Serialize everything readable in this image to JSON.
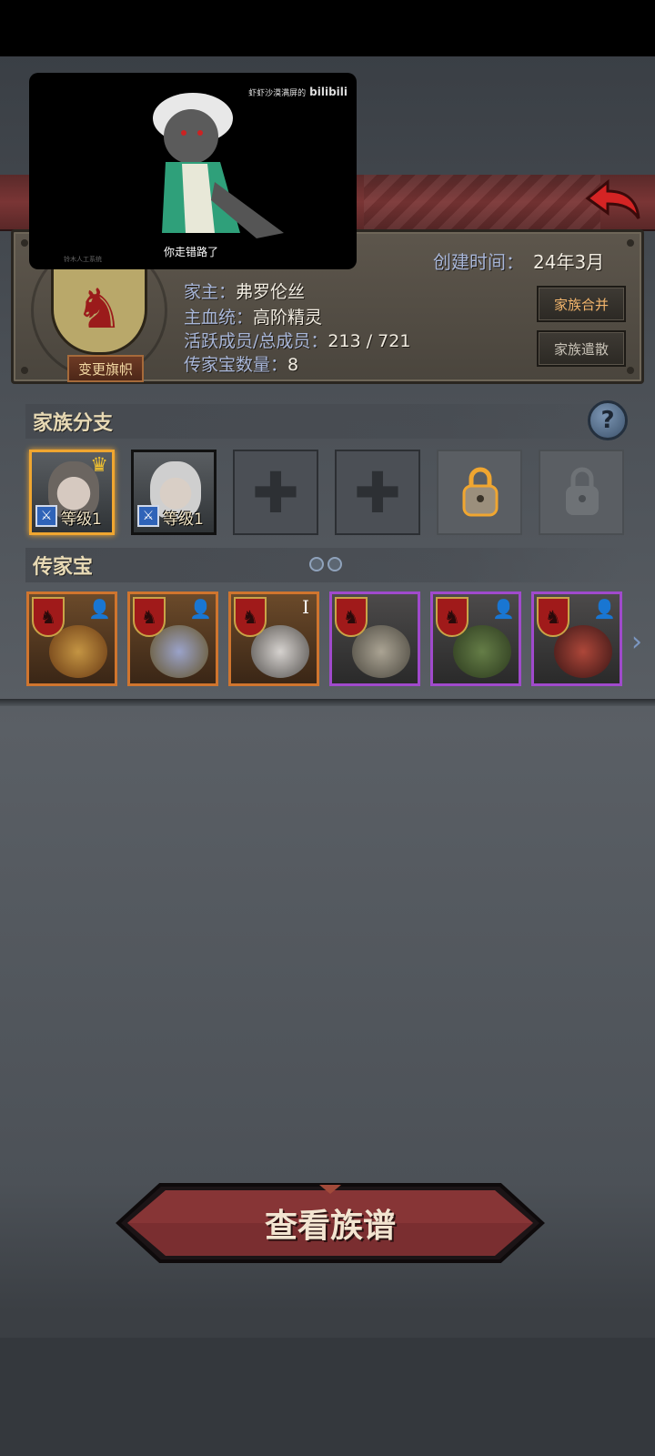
{
  "video": {
    "watermark_text": "虾虾沙漠满屏的",
    "watermark_logo": "bilibili",
    "subtitle": "你走错路了",
    "corner_text": "铃木人工系统"
  },
  "family": {
    "created_label": "创建时间：",
    "created_value": "24年3月",
    "head_label": "家主：",
    "head_value": "弗罗伦丝",
    "bloodline_label": "主血统：",
    "bloodline_value": "高阶精灵",
    "members_label": "活跃成员/总成员：",
    "members_value": "213 / 721",
    "heirloom_count_label": "传家宝数量：",
    "heirloom_count_value": "8",
    "change_flag_label": "变更旗帜",
    "merge_label": "家族合并",
    "disband_label": "家族遣散"
  },
  "branches": {
    "title": "家族分支",
    "help": "?",
    "members": [
      {
        "level": "等级1",
        "leader": true
      },
      {
        "level": "等级1",
        "leader": false
      }
    ]
  },
  "heirlooms": {
    "title": "传家宝",
    "items": [
      {
        "rarity": "legendary",
        "owned": true,
        "tier": ""
      },
      {
        "rarity": "legendary",
        "owned": true,
        "tier": ""
      },
      {
        "rarity": "legendary",
        "owned": false,
        "tier": "I"
      },
      {
        "rarity": "epic",
        "owned": false,
        "tier": ""
      },
      {
        "rarity": "epic",
        "owned": true,
        "tier": ""
      },
      {
        "rarity": "epic",
        "owned": true,
        "tier": ""
      }
    ]
  },
  "actions": {
    "view_family_tree": "查看族谱"
  },
  "colors": {
    "accent_gold": "#f0a630",
    "legendary_border": "#d0752e",
    "epic_border": "#a04acc",
    "banner_red": "#7a3535"
  }
}
